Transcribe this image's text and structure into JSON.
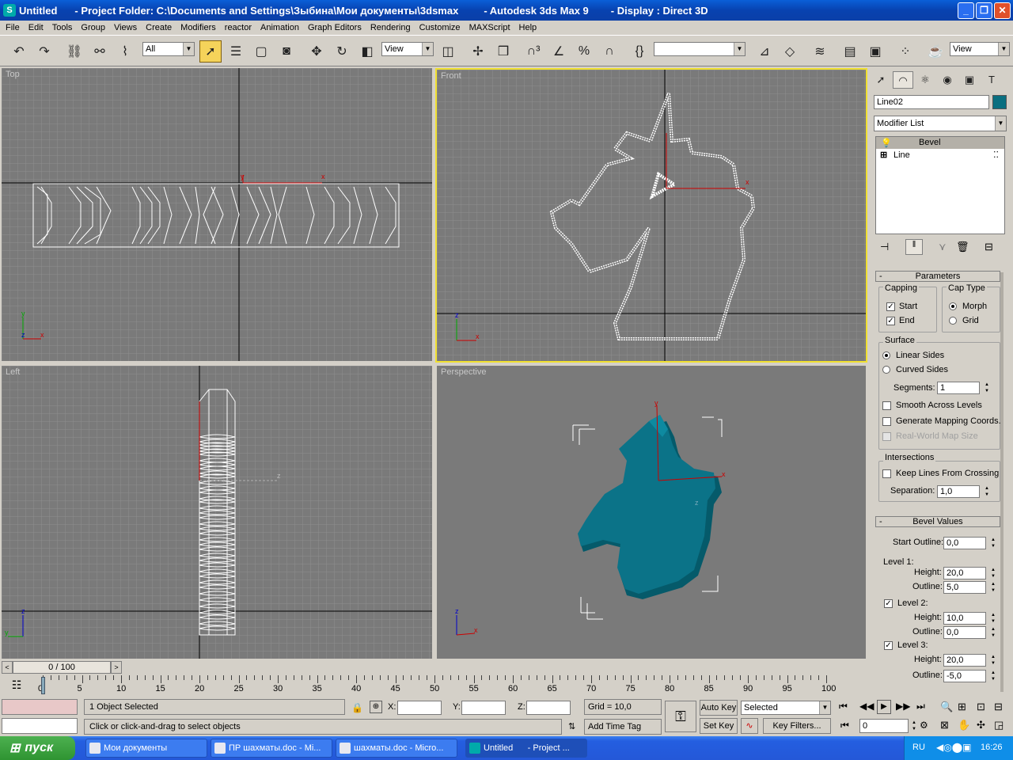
{
  "window": {
    "title_app": "Untitled",
    "title_folder": "- Project Folder: C:\\Documents and Settings\\Зыбина\\Мои документы\\3dsmax",
    "title_product": "- Autodesk 3ds Max 9",
    "title_display": "- Display : Direct 3D"
  },
  "menu": [
    "File",
    "Edit",
    "Tools",
    "Group",
    "Views",
    "Create",
    "Modifiers",
    "reactor",
    "Animation",
    "Graph Editors",
    "Rendering",
    "Customize",
    "MAXScript",
    "Help"
  ],
  "toolbar": {
    "selection_filter": "All",
    "ref_coord": "View",
    "named_selection": "",
    "render_view": "View"
  },
  "viewports": {
    "top": "Top",
    "front": "Front",
    "left": "Left",
    "perspective": "Perspective"
  },
  "panel": {
    "object_name": "Line02",
    "object_color": "#0a6f80",
    "modifier_list": "Modifier List",
    "stack": [
      {
        "label": "Bevel"
      },
      {
        "label": "Line"
      }
    ],
    "parameters": {
      "header": "Parameters",
      "capping_title": "Capping",
      "start": "Start",
      "end": "End",
      "cap_type_title": "Cap Type",
      "morph": "Morph",
      "grid": "Grid",
      "surface_title": "Surface",
      "linear_sides": "Linear Sides",
      "curved_sides": "Curved Sides",
      "segments_label": "Segments:",
      "segments_value": "1",
      "smooth_across": "Smooth Across Levels",
      "gen_mapping": "Generate Mapping Coords.",
      "real_world": "Real-World Map Size",
      "intersections_title": "Intersections",
      "keep_lines": "Keep Lines From Crossing",
      "separation_label": "Separation:",
      "separation_value": "1,0"
    },
    "bevel": {
      "header": "Bevel Values",
      "start_outline_label": "Start Outline:",
      "start_outline_value": "0,0",
      "level1": "Level 1:",
      "l1_height": "20,0",
      "l1_outline": "5,0",
      "level2": "Level 2:",
      "l2_height": "10,0",
      "l2_outline": "0,0",
      "level3": "Level 3:",
      "l3_height": "20,0",
      "l3_outline": "-5,0",
      "height_label": "Height:",
      "outline_label": "Outline:",
      "collapse": "-"
    }
  },
  "timeline": {
    "frame_display": "0 / 100",
    "ticks": [
      "0",
      "5",
      "10",
      "15",
      "20",
      "25",
      "30",
      "35",
      "40",
      "45",
      "50",
      "55",
      "60",
      "65",
      "70",
      "75",
      "80",
      "85",
      "90",
      "95",
      "100"
    ]
  },
  "status": {
    "selected": "1 Object Selected",
    "prompt": "Click or click-and-drag to select objects",
    "x_label": "X:",
    "y_label": "Y:",
    "z_label": "Z:",
    "grid": "Grid = 10,0",
    "add_time_tag": "Add Time Tag",
    "auto_key": "Auto Key",
    "set_key": "Set Key",
    "selected_combo": "Selected",
    "key_filters": "Key Filters...",
    "frame_field": "0"
  },
  "taskbar": {
    "start": "пуск",
    "items": [
      {
        "label": "Мои документы"
      },
      {
        "label": "ПР шахматы.doc - Mi..."
      },
      {
        "label": "шахматы.doc - Micro..."
      },
      {
        "label": "Untitled      - Project ..."
      }
    ],
    "lang": "RU",
    "time": "16:26"
  }
}
